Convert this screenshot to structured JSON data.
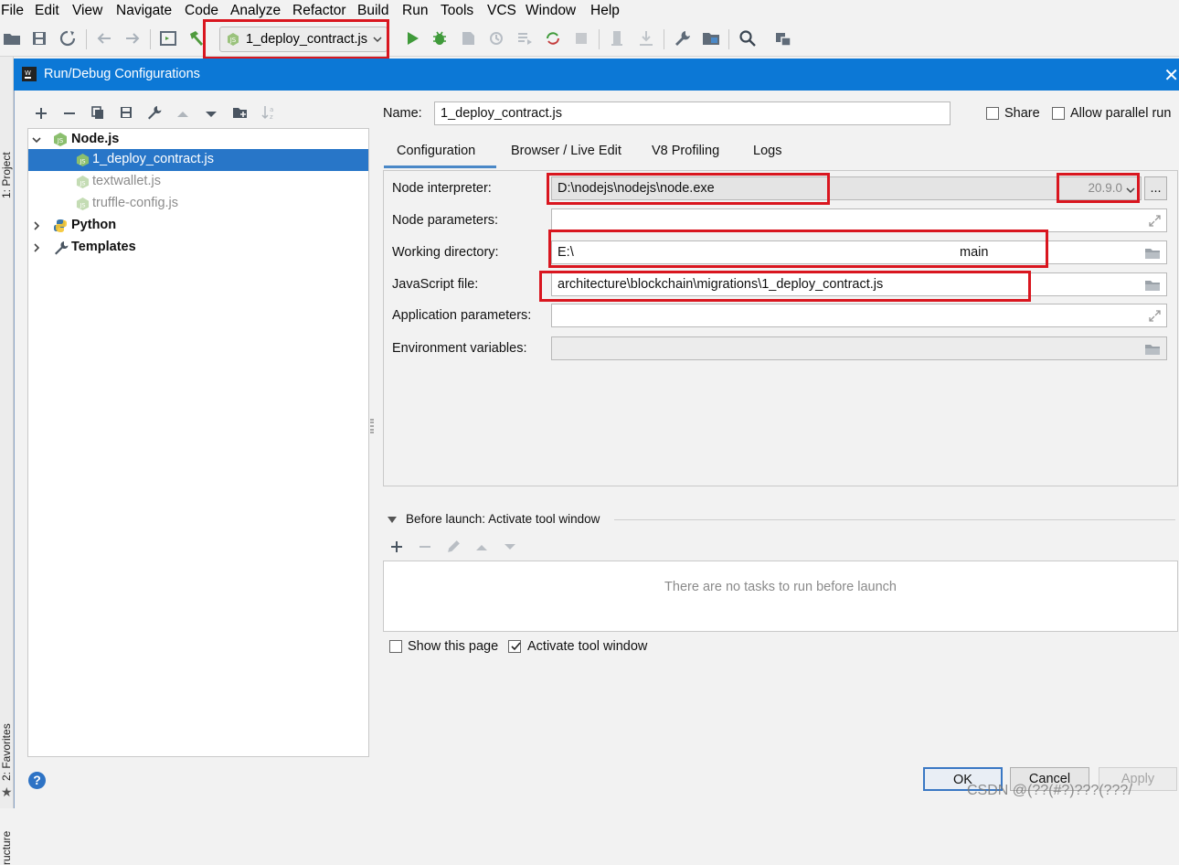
{
  "menu": [
    "File",
    "Edit",
    "View",
    "Navigate",
    "Code",
    "Analyze",
    "Refactor",
    "Build",
    "Run",
    "Tools",
    "VCS",
    "Window",
    "Help"
  ],
  "toolbar": {
    "run_config": "1_deploy_contract.js"
  },
  "side_tabs": {
    "project": "1: Project",
    "favorites": "2: Favorites",
    "structure": "ructure"
  },
  "dialog": {
    "title": "Run/Debug Configurations",
    "tree": {
      "nodejs": "Node.js",
      "items": [
        "1_deploy_contract.js",
        "textwallet.js",
        "truffle-config.js"
      ],
      "python": "Python",
      "templates": "Templates"
    },
    "name_label": "Name:",
    "name_value": "1_deploy_contract.js",
    "share_label": "Share",
    "parallel_label": "Allow parallel run",
    "tabs": [
      "Configuration",
      "Browser / Live Edit",
      "V8 Profiling",
      "Logs"
    ],
    "fields": {
      "node_interpreter_label": "Node interpreter:",
      "node_interpreter_value": "D:\\nodejs\\nodejs\\node.exe",
      "node_version": "20.9.0",
      "more_button": "...",
      "node_parameters_label": "Node parameters:",
      "working_dir_label": "Working directory:",
      "working_dir_value": "E:\\",
      "working_dir_suffix": "main",
      "js_file_label": "JavaScript file:",
      "js_file_value": "architecture\\blockchain\\migrations\\1_deploy_contract.js",
      "app_params_label": "Application parameters:",
      "env_vars_label": "Environment variables:"
    },
    "before_launch": "Before launch: Activate tool window",
    "no_tasks": "There are no tasks to run before launch",
    "show_page_label": "Show this page",
    "activate_label": "Activate tool window",
    "buttons": {
      "ok": "OK",
      "cancel": "Cancel",
      "apply": "Apply"
    },
    "help": "?"
  },
  "watermark": "CSDN @(??(#?)???(???/"
}
